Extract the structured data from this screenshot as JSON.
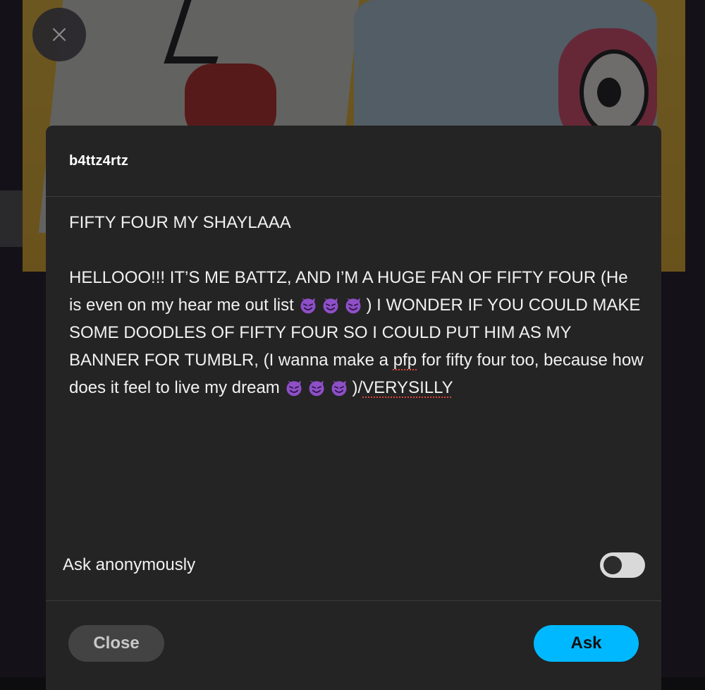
{
  "dialog": {
    "username": "b4ttz4rtz",
    "message": {
      "subject": "FIFTY FOUR MY SHAYLAAA",
      "parts": [
        {
          "text": "HELLOOO!!! IT’S ME BATTZ, AND I’M A HUGE FAN OF FIFTY FOUR (He is even on my hear me out list "
        },
        {
          "emoji": "smiling-imp"
        },
        {
          "emoji": "smiling-imp"
        },
        {
          "emoji": "smiling-imp"
        },
        {
          "text": ") I WONDER IF YOU COULD MAKE SOME DOODLES OF FIFTY FOUR SO I COULD PUT HIM AS MY BANNER FOR TUMBLR, (I wanna make a "
        },
        {
          "text": "pfp",
          "misspelled": true
        },
        {
          "text": " for fifty four too, because how does it feel to live my dream "
        },
        {
          "emoji": "smiling-imp"
        },
        {
          "emoji": "smiling-imp"
        },
        {
          "emoji": "smiling-imp"
        },
        {
          "text": ")/"
        },
        {
          "text": "VERYSILLY",
          "misspelled": true
        }
      ]
    },
    "ask_anonymously": {
      "label": "Ask anonymously",
      "enabled": false
    },
    "buttons": {
      "close_label": "Close",
      "ask_label": "Ask"
    }
  },
  "colors": {
    "dialog_bg": "#242424",
    "ask_button": "#00b8ff",
    "close_button": "#434343",
    "spellcheck_underline": "#e0453b",
    "devil_emoji": "#8e4fc7"
  },
  "icons": {
    "dismiss": "close-icon",
    "emoji": "smiling-imp-emoji-icon"
  }
}
